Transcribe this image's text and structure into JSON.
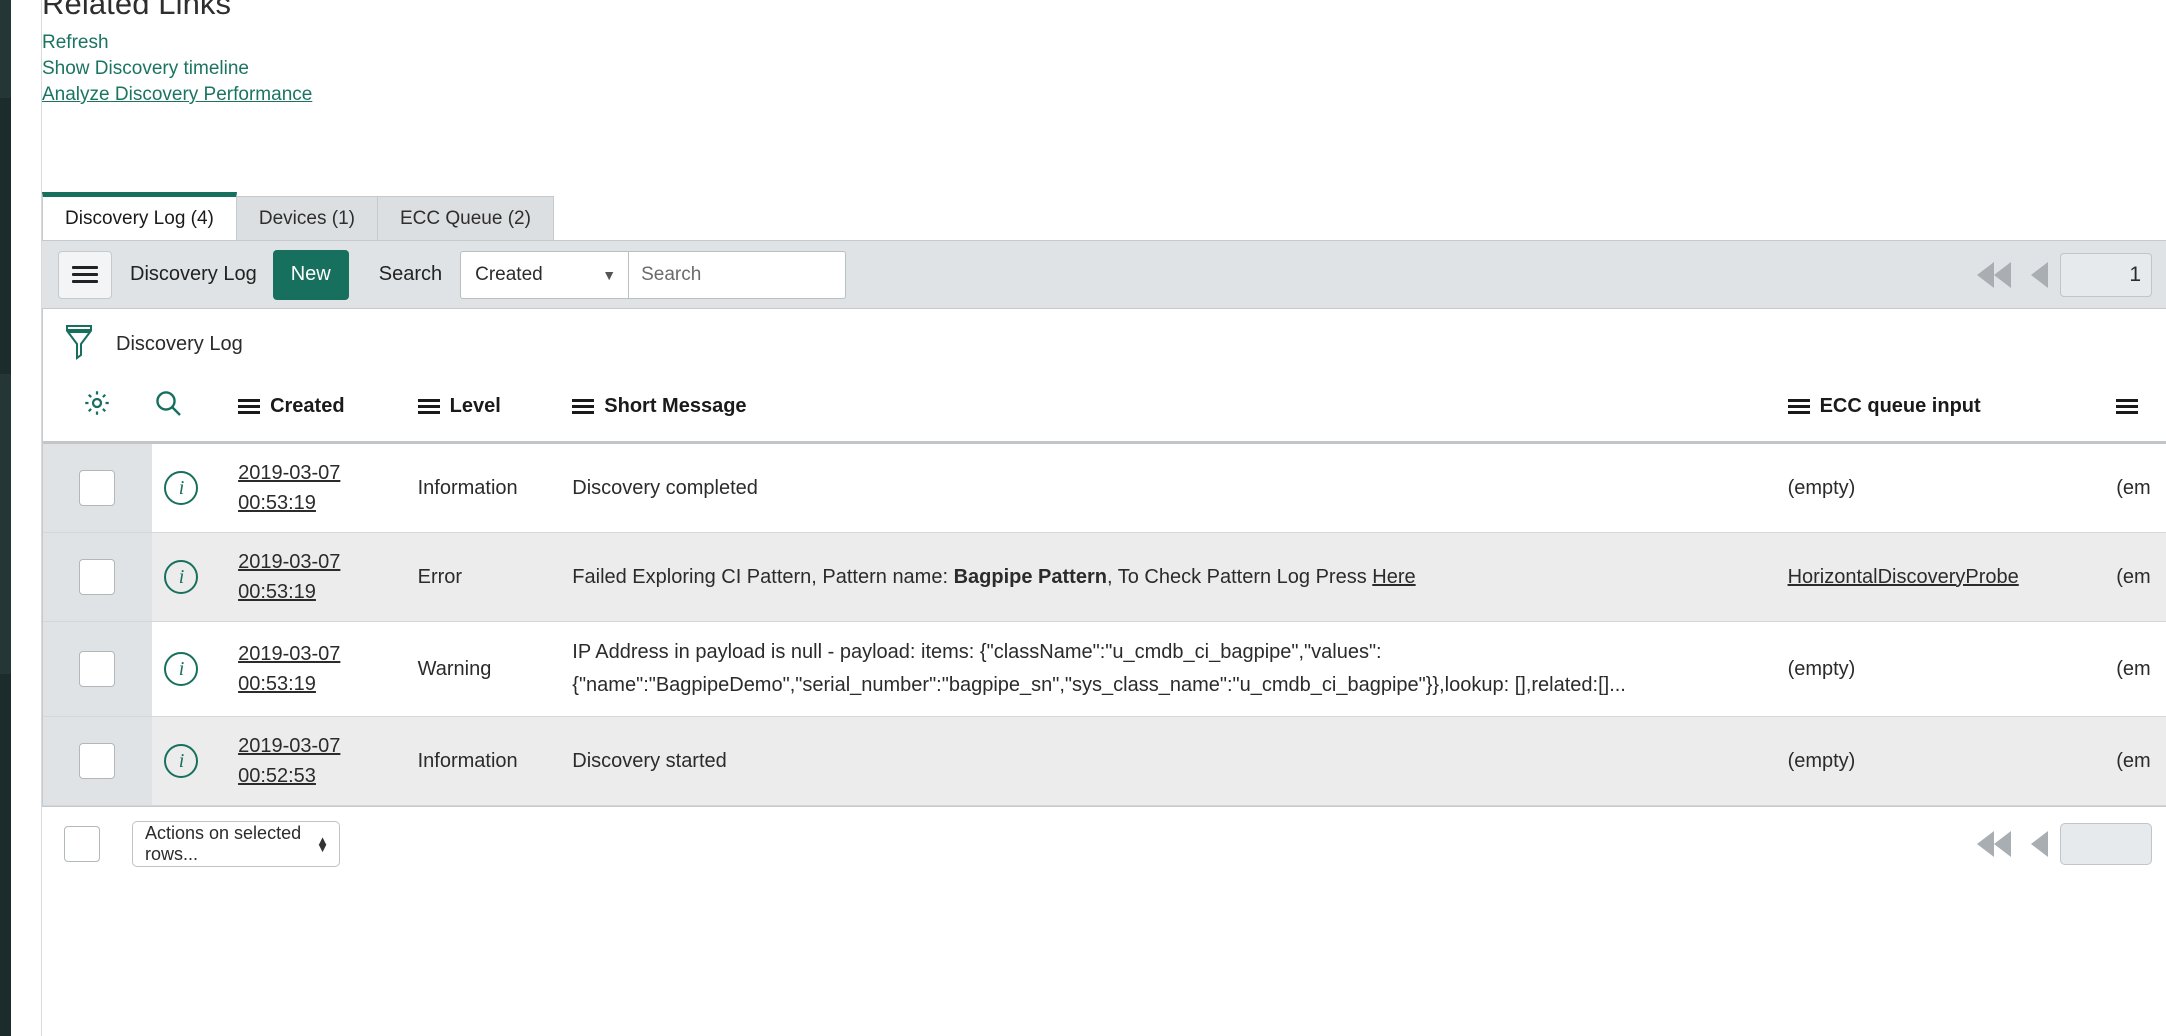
{
  "page": {
    "title": "Related Links"
  },
  "related_links": [
    {
      "label": "Refresh",
      "underlined": false
    },
    {
      "label": "Show Discovery timeline",
      "underlined": false
    },
    {
      "label": "Analyze Discovery Performance",
      "underlined": true
    }
  ],
  "tabs": [
    {
      "label": "Discovery Log (4)",
      "active": true
    },
    {
      "label": "Devices (1)",
      "active": false
    },
    {
      "label": "ECC Queue (2)",
      "active": false
    }
  ],
  "toolbar": {
    "menu_icon": "hamburger-icon",
    "list_title": "Discovery Log",
    "new_label": "New",
    "search_label": "Search",
    "search_field_selected": "Created",
    "search_placeholder": "Search",
    "caret": "▼",
    "page_number": "1"
  },
  "filter_bar": {
    "icon": "funnel-icon",
    "text": "Discovery Log"
  },
  "table": {
    "tools": {
      "gear": "gear-icon",
      "search": "magnifier-icon"
    },
    "columns": [
      {
        "key": "created",
        "label": "Created"
      },
      {
        "key": "level",
        "label": "Level"
      },
      {
        "key": "message",
        "label": "Short Message"
      },
      {
        "key": "ecc_queue_input",
        "label": "ECC queue input"
      },
      {
        "key": "truncated",
        "label": ""
      }
    ],
    "rows": [
      {
        "created_date": "2019-03-07",
        "created_time": "00:53:19",
        "level": "Information",
        "message_pre": "Discovery completed",
        "message_bold": "",
        "message_mid": "",
        "message_link": "",
        "ecc_queue_input": "(empty)",
        "ecc_is_link": false,
        "truncated": "(em"
      },
      {
        "created_date": "2019-03-07",
        "created_time": "00:53:19",
        "level": "Error",
        "message_pre": "Failed Exploring CI Pattern, Pattern name: ",
        "message_bold": "Bagpipe Pattern",
        "message_mid": ", To Check Pattern Log Press ",
        "message_link": "Here",
        "ecc_queue_input": "HorizontalDiscoveryProbe",
        "ecc_is_link": true,
        "truncated": "(em"
      },
      {
        "created_date": "2019-03-07",
        "created_time": "00:53:19",
        "level": "Warning",
        "message_pre": "IP Address in payload is null - payload: items: {\"className\":\"u_cmdb_ci_bagpipe\",\"values\": {\"name\":\"BagpipeDemo\",\"serial_number\":\"bagpipe_sn\",\"sys_class_name\":\"u_cmdb_ci_bagpipe\"}},lookup: [],related:[]...",
        "message_bold": "",
        "message_mid": "",
        "message_link": "",
        "ecc_queue_input": "(empty)",
        "ecc_is_link": false,
        "truncated": "(em"
      },
      {
        "created_date": "2019-03-07",
        "created_time": "00:52:53",
        "level": "Information",
        "message_pre": "Discovery started",
        "message_bold": "",
        "message_mid": "",
        "message_link": "",
        "ecc_queue_input": "(empty)",
        "ecc_is_link": false,
        "truncated": "(em"
      }
    ]
  },
  "footer": {
    "actions_label": "Actions on selected rows..."
  },
  "colors": {
    "brand_green": "#17705e",
    "link_green": "#1b7461",
    "toolbar_bg": "#dfe3e5",
    "row_alt_bg": "#ececec",
    "rail_dark": "#1c2b2b"
  }
}
